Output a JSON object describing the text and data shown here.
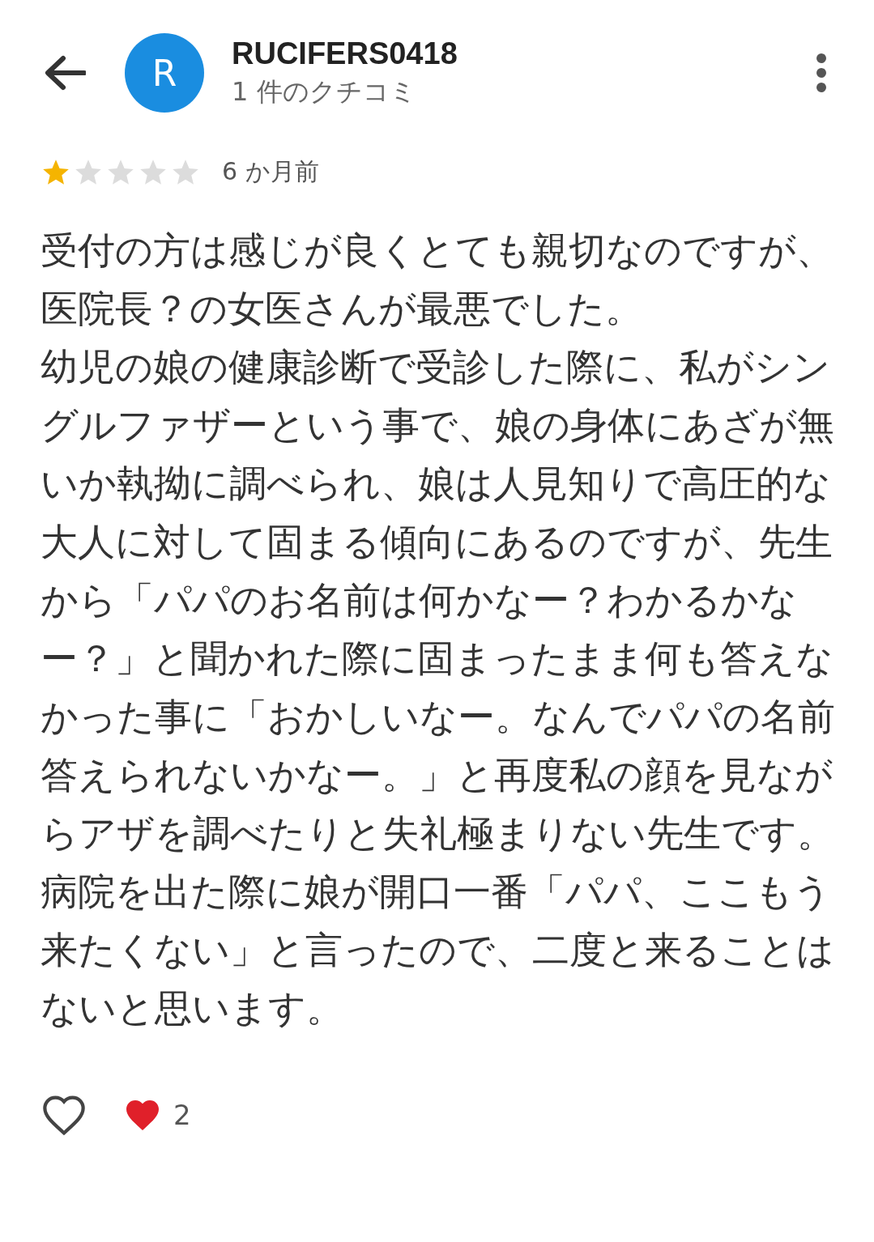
{
  "header": {
    "avatar_letter": "R",
    "name": "RUCIFERS0418",
    "review_count": "1 件のクチコミ"
  },
  "review": {
    "stars": 1,
    "time": "6 か月前",
    "paragraphs": [
      "受付の方は感じが良くとても親切なのですが、医院長？の女医さんが最悪でした。",
      "幼児の娘の健康診断で受診した際に、私がシングルファザーという事で、娘の身体にあざが無いか執拗に調べられ、娘は人見知りで高圧的な大人に対して固まる傾向にあるのですが、先生から「パパのお名前は何かなー？わかるかなー？」と聞かれた際に固まったまま何も答えなかった事に「おかしいなー。なんでパパの名前答えられないかなー。」と再度私の顔を見ながらアザを調べたりと失礼極まりない先生です。",
      "病院を出た際に娘が開口一番「パパ、ここもう来たくない」と言ったので、二度と来ることはないと思います。"
    ]
  },
  "reactions": {
    "like_count": "2"
  }
}
